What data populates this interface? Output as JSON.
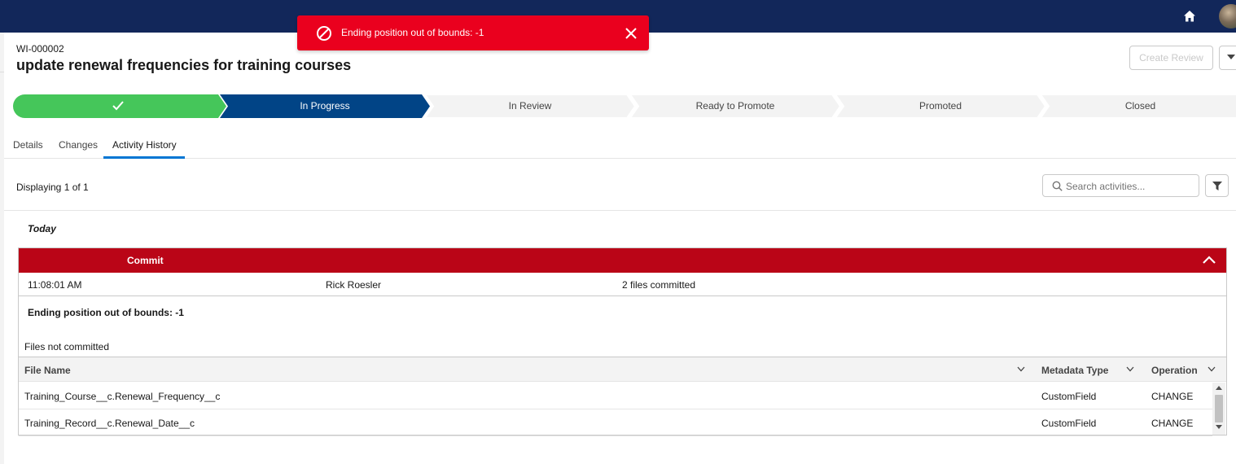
{
  "toast": {
    "message": "Ending position out of bounds: -1",
    "icon": "ban-icon",
    "color": "#ea001e"
  },
  "record": {
    "id": "WI-000002",
    "title": "update renewal frequencies for training courses"
  },
  "actions": {
    "create_review_label": "Create Review"
  },
  "path": {
    "stages": [
      {
        "label": "",
        "state": "complete",
        "icon": "check-icon"
      },
      {
        "label": "In Progress",
        "state": "current"
      },
      {
        "label": "In Review",
        "state": "incomplete"
      },
      {
        "label": "Ready to Promote",
        "state": "incomplete"
      },
      {
        "label": "Promoted",
        "state": "incomplete"
      },
      {
        "label": "Closed",
        "state": "incomplete"
      }
    ],
    "colors": {
      "complete": "#45c65a",
      "current": "#014486",
      "incomplete": "#f3f3f3"
    }
  },
  "tabs": [
    {
      "label": "Details",
      "active": false
    },
    {
      "label": "Changes",
      "active": false
    },
    {
      "label": "Activity History",
      "active": true
    }
  ],
  "activity": {
    "displaying": "Displaying 1 of 1",
    "search_placeholder": "Search activities...",
    "group_label": "Today",
    "card": {
      "title": "Commit",
      "header_color": "#ba0517",
      "time": "11:08:01 AM",
      "user": "Rick Roesler",
      "summary": "2 files committed",
      "error": "Ending position out of bounds: -1",
      "section_label": "Files not committed",
      "columns": [
        "File Name",
        "Metadata Type",
        "Operation"
      ],
      "rows": [
        [
          "Training_Course__c.Renewal_Frequency__c",
          "CustomField",
          "CHANGE"
        ],
        [
          "Training_Record__c.Renewal_Date__c",
          "CustomField",
          "CHANGE"
        ]
      ]
    }
  }
}
